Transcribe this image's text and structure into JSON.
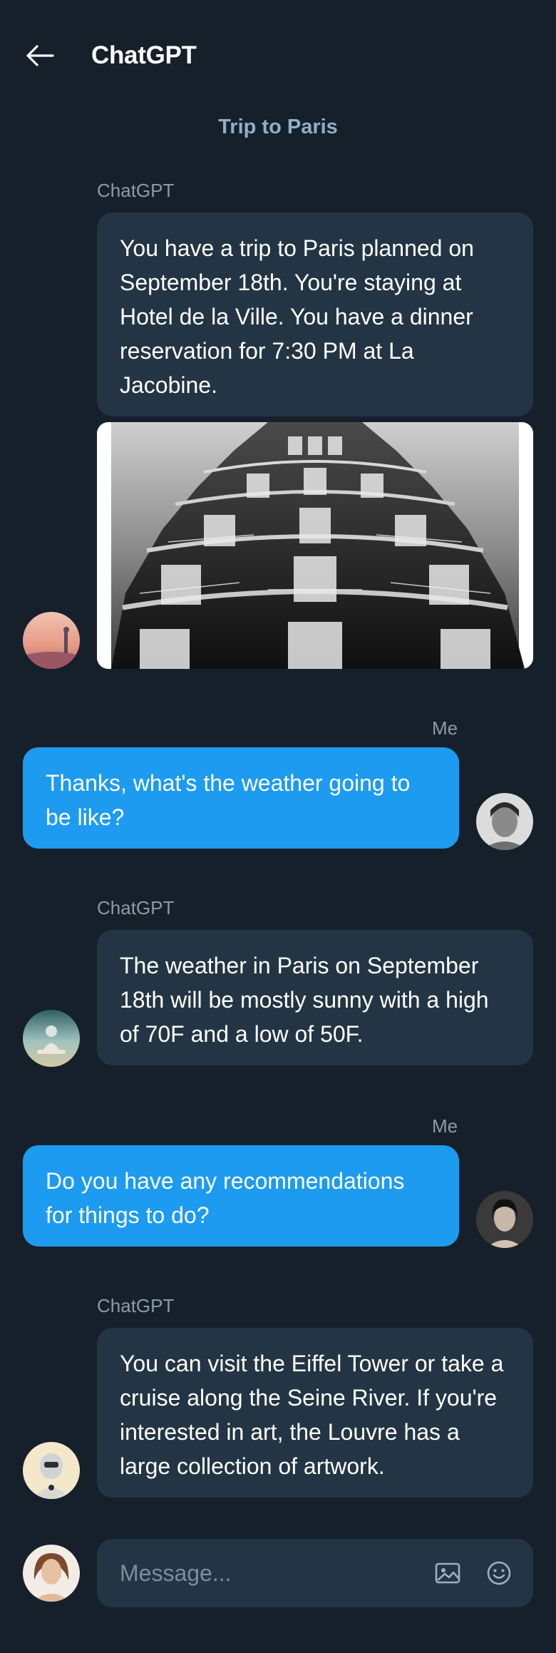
{
  "header": {
    "title": "ChatGPT",
    "conversation_title": "Trip to Paris"
  },
  "messages": [
    {
      "sender": "ChatGPT",
      "text": "You have a trip to Paris planned on September 18th. You're staying at Hotel de la Ville. You have a dinner reservation for 7:30 PM at La Jacobine."
    },
    {
      "sender": "Me",
      "text": "Thanks, what's the weather going to be like?"
    },
    {
      "sender": "ChatGPT",
      "text": "The weather in Paris on September 18th will be mostly sunny with a high of 70F and a low of 50F."
    },
    {
      "sender": "Me",
      "text": "Do you have any recommendations for things to do?"
    },
    {
      "sender": "ChatGPT",
      "text": "You can visit the Eiffel Tower or take a cruise along the Seine River. If you're interested in art, the Louvre has a large collection of artwork."
    }
  ],
  "composer": {
    "placeholder": "Message..."
  },
  "icons": {
    "back": "arrow-left-icon",
    "attach": "image-icon",
    "emoji": "smiley-icon"
  },
  "colors": {
    "background": "#15202b",
    "bot_bubble": "#233544",
    "user_bubble": "#1d9bf0",
    "title_accent": "#8fb0c6"
  }
}
